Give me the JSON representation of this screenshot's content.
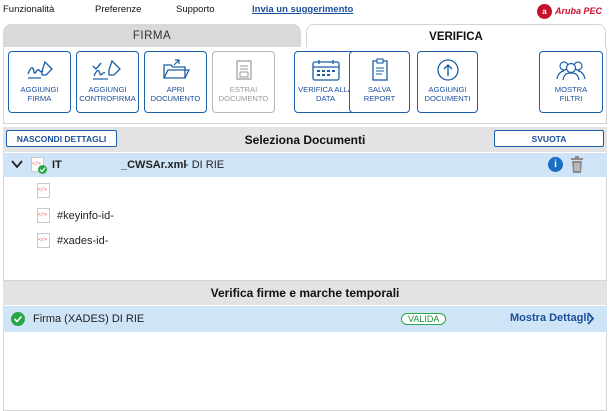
{
  "menubar": {
    "items": [
      "Funzionalità",
      "Preferenze",
      "Supporto"
    ],
    "link": "Invia un suggerimento",
    "logo_text": "Aruba PEC"
  },
  "tabs": [
    {
      "label": "FIRMA"
    },
    {
      "label": "VERIFICA"
    }
  ],
  "toolbar": {
    "buttons": [
      {
        "label": "AGGIUNGI\nFIRMA",
        "icon": "signature-icon",
        "disabled": false
      },
      {
        "label": "AGGIUNGI\nCONTROFIRMA",
        "icon": "countersign-icon",
        "disabled": false
      },
      {
        "label": "APRI\nDOCUMENTO",
        "icon": "folder-open-icon",
        "disabled": false
      },
      {
        "label": "ESTRAI\nDOCUMENTO",
        "icon": "extract-icon",
        "disabled": true
      },
      {
        "label": "VERIFICA ALLA\nDATA",
        "icon": "calendar-icon",
        "disabled": false
      },
      {
        "label": "SALVA\nREPORT",
        "icon": "report-icon",
        "disabled": false
      },
      {
        "label": "AGGIUNGI\nDOCUMENTI",
        "icon": "upload-icon",
        "disabled": false
      },
      {
        "label": "MOSTRA\nFILTRI",
        "icon": "users-filter-icon",
        "disabled": false
      }
    ]
  },
  "documents": {
    "hide_details_label": "NASCONDI DETTAGLI",
    "title": "Seleziona Documenti",
    "clear_label": "SVUOTA",
    "file": {
      "name_prefix": "IT",
      "name_suffix": "_CWSAr.xml",
      "signer": " - DI RIE"
    },
    "children": [
      "",
      "#keyinfo-id-",
      "#xades-id-"
    ]
  },
  "verification": {
    "title": "Verifica firme e marche temporali",
    "entry": {
      "label": "Firma (XADES) DI RIE",
      "status": "VALIDA",
      "details_link": "Mostra Dettagli"
    }
  },
  "colors": {
    "accent": "#1a5fa8",
    "selected_row": "#cfe4f7",
    "valid": "#27a844"
  }
}
